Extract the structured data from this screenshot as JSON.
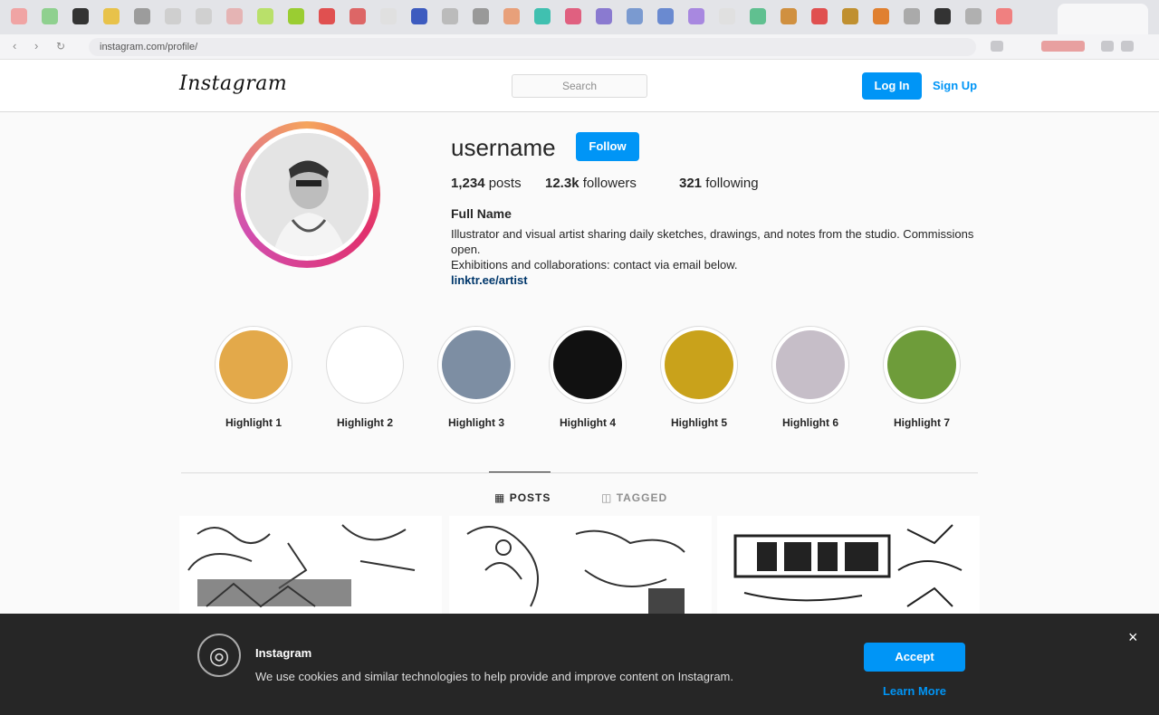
{
  "browser": {
    "url": "instagram.com/profile/",
    "tab_colors": [
      "#f0a4a4",
      "#8fd08f",
      "#333333",
      "#e8c24a",
      "#9c9c9c",
      "#cfcfcf",
      "#d0d0d0",
      "#e5b4b4",
      "#b9e06a",
      "#9acd32",
      "#e05050",
      "#d66",
      "#e0e0e0",
      "#3d5bbf",
      "#bbbbbb",
      "#999999",
      "#e8a07a",
      "#40c0b0",
      "#e06080",
      "#8a7ad0",
      "#7a9ad0",
      "#6a8ad0",
      "#a888e0",
      "#e0e0e0",
      "#60c090",
      "#d09040",
      "#e05050",
      "#c09030",
      "#e08030",
      "#aaaaaa",
      "#333333",
      "#b0b0b0",
      "#f08080"
    ]
  },
  "header": {
    "logo": "Instagram",
    "search_placeholder": "Search",
    "login_label": "Log In",
    "signup_label": "Sign Up"
  },
  "profile": {
    "username": "username",
    "follow_label": "Follow",
    "stats": [
      {
        "value": "1,234",
        "label": "posts"
      },
      {
        "value": "12.3k",
        "label": "followers"
      },
      {
        "value": "321",
        "label": "following"
      }
    ],
    "full_name": "Full Name",
    "bio_line1": "Illustrator and visual artist sharing daily sketches, drawings, and notes from the studio. Commissions open.",
    "bio_line2": "Exhibitions and collaborations: contact via email below.",
    "link": "linktr.ee/artist"
  },
  "highlights": [
    {
      "label": "Highlight 1",
      "color": "#e3a94a"
    },
    {
      "label": "Highlight 2",
      "color": "#ffffff"
    },
    {
      "label": "Highlight 3",
      "color": "#7d8ea3"
    },
    {
      "label": "Highlight 4",
      "color": "#111111"
    },
    {
      "label": "Highlight 5",
      "color": "#c9a21b"
    },
    {
      "label": "Highlight 6",
      "color": "#c6bec8"
    },
    {
      "label": "Highlight 7",
      "color": "#6e9c3a"
    }
  ],
  "tabs": {
    "posts": "POSTS",
    "tagged": "TAGGED"
  },
  "banner": {
    "title": "Instagram",
    "text": "We use cookies and similar technologies to help provide and improve content on Instagram.",
    "accept_label": "Accept",
    "more_label": "Learn More"
  },
  "accent": "#0095f6"
}
